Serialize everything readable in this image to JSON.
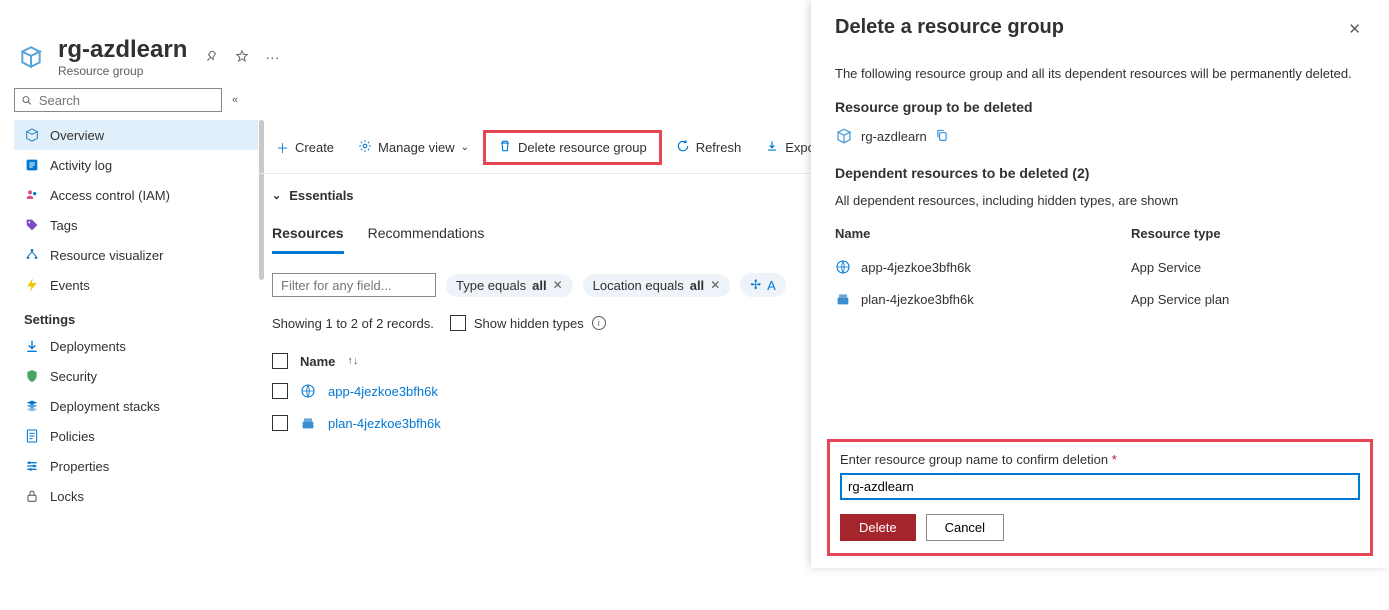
{
  "header": {
    "title": "rg-azdlearn",
    "subtitle": "Resource group"
  },
  "search": {
    "placeholder": "Search"
  },
  "nav": {
    "items": [
      {
        "label": "Overview"
      },
      {
        "label": "Activity log"
      },
      {
        "label": "Access control (IAM)"
      },
      {
        "label": "Tags"
      },
      {
        "label": "Resource visualizer"
      },
      {
        "label": "Events"
      }
    ],
    "settings_label": "Settings",
    "settings_items": [
      {
        "label": "Deployments"
      },
      {
        "label": "Security"
      },
      {
        "label": "Deployment stacks"
      },
      {
        "label": "Policies"
      },
      {
        "label": "Properties"
      },
      {
        "label": "Locks"
      }
    ]
  },
  "toolbar": {
    "create": "Create",
    "manage_view": "Manage view",
    "delete_rg": "Delete resource group",
    "refresh": "Refresh",
    "export": "Expor"
  },
  "essentials_label": "Essentials",
  "tabs": {
    "resources": "Resources",
    "recommendations": "Recommendations"
  },
  "filter": {
    "placeholder": "Filter for any field...",
    "type_prefix": "Type equals ",
    "type_value": "all",
    "loc_prefix": "Location equals ",
    "loc_value": "all",
    "add": "A"
  },
  "records": {
    "showing": "Showing 1 to 2 of 2 records.",
    "hidden_label": "Show hidden types"
  },
  "table": {
    "name_header": "Name",
    "rows": [
      {
        "name": "app-4jezkoe3bfh6k"
      },
      {
        "name": "plan-4jezkoe3bfh6k"
      }
    ]
  },
  "panel": {
    "title": "Delete a resource group",
    "description": "The following resource group and all its dependent resources will be permanently deleted.",
    "rg_section": "Resource group to be deleted",
    "rg_name": "rg-azdlearn",
    "dep_section": "Dependent resources to be deleted (2)",
    "dep_desc": "All dependent resources, including hidden types, are shown",
    "col_name": "Name",
    "col_type": "Resource type",
    "dep_rows": [
      {
        "name": "app-4jezkoe3bfh6k",
        "type": "App Service"
      },
      {
        "name": "plan-4jezkoe3bfh6k",
        "type": "App Service plan"
      }
    ],
    "confirm_label": "Enter resource group name to confirm deletion",
    "confirm_value": "rg-azdlearn",
    "delete_btn": "Delete",
    "cancel_btn": "Cancel"
  }
}
